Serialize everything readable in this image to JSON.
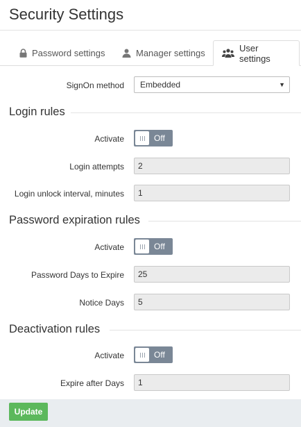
{
  "page": {
    "title": "Security Settings"
  },
  "tabs": [
    {
      "label": "Password settings",
      "icon": "lock-icon"
    },
    {
      "label": "Manager settings",
      "icon": "user-icon"
    },
    {
      "label": "User settings",
      "icon": "users-icon",
      "active": true
    }
  ],
  "signon": {
    "label": "SignOn method",
    "value": "Embedded"
  },
  "login_rules": {
    "title": "Login rules",
    "activate_label": "Activate",
    "activate_state": "Off",
    "attempts_label": "Login attempts",
    "attempts_value": "2",
    "unlock_label": "Login unlock interval, minutes",
    "unlock_value": "1"
  },
  "password_rules": {
    "title": "Password expiration rules",
    "activate_label": "Activate",
    "activate_state": "Off",
    "days_label": "Password Days to Expire",
    "days_value": "25",
    "notice_label": "Notice Days",
    "notice_value": "5"
  },
  "deactivation_rules": {
    "title": "Deactivation rules",
    "activate_label": "Activate",
    "activate_state": "Off",
    "expire_label": "Expire after Days",
    "expire_value": "1"
  },
  "footer": {
    "update_label": "Update"
  },
  "colors": {
    "accent_green": "#5cb85c",
    "toggle_off": "#7a8796",
    "input_bg": "#ebebeb"
  }
}
